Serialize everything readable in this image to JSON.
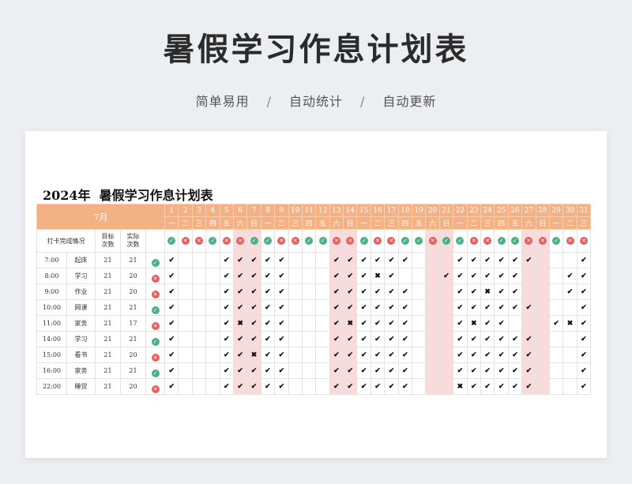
{
  "header": {
    "title": "暑假学习作息计划表",
    "features": [
      "简单易用",
      "自动统计",
      "自动更新"
    ],
    "separator": "/"
  },
  "sheet": {
    "title": "2024年  暑假学习作息计划表",
    "month": "7月",
    "stat_label": "打卡完成情况",
    "target_label": "目标\n次数",
    "actual_label": "实际\n次数",
    "days": [
      "1",
      "2",
      "3",
      "4",
      "5",
      "6",
      "7",
      "8",
      "9",
      "10",
      "11",
      "12",
      "13",
      "14",
      "15",
      "16",
      "17",
      "18",
      "19",
      "20",
      "21",
      "22",
      "23",
      "24",
      "25",
      "26",
      "27",
      "28",
      "29",
      "30",
      "31"
    ],
    "weekdays": [
      "一",
      "二",
      "三",
      "四",
      "五",
      "六",
      "日",
      "一",
      "二",
      "三",
      "四",
      "五",
      "六",
      "日",
      "一",
      "二",
      "三",
      "四",
      "五",
      "六",
      "日",
      "一",
      "二",
      "三",
      "四",
      "五",
      "六",
      "日",
      "一",
      "二",
      "三"
    ],
    "weekend_days": [
      "6",
      "7",
      "13",
      "14",
      "20",
      "21",
      "27",
      "28"
    ],
    "day_status": [
      "ok",
      "no",
      "no",
      "ok",
      "no",
      "no",
      "ok",
      "ok",
      "no",
      "no",
      "ok",
      "ok",
      "no",
      "no",
      "ok",
      "no",
      "no",
      "ok",
      "ok",
      "no",
      "ok",
      "ok",
      "no",
      "no",
      "ok",
      "ok",
      "no",
      "no",
      "ok",
      "no",
      "no"
    ],
    "rows": [
      {
        "time": "7:00",
        "task": "起床",
        "target": "21",
        "actual": "21",
        "status": "ok",
        "marks": "c---ccccc---cccccc---cccccc---cc"
      },
      {
        "time": "8:00",
        "task": "学习",
        "target": "21",
        "actual": "20",
        "status": "no",
        "marks": "c---ccccc---cccxc---cccccc---cc"
      },
      {
        "time": "9:00",
        "task": "作业",
        "target": "21",
        "actual": "20",
        "status": "no",
        "marks": "c---ccccc---cccccc---ccxcc---cc"
      },
      {
        "time": "10:00",
        "task": "网课",
        "target": "21",
        "actual": "21",
        "status": "ok",
        "marks": "c---ccccc---cccccc---cccccc---cc"
      },
      {
        "time": "11:00",
        "task": "家务",
        "target": "21",
        "actual": "17",
        "status": "no",
        "marks": "c---cxccc---cxcccc---cxcc---cxc"
      },
      {
        "time": "14:00",
        "task": "学习",
        "target": "21",
        "actual": "21",
        "status": "ok",
        "marks": "c---ccccc---cccccc---cccccc---cc"
      },
      {
        "time": "15:00",
        "task": "看书",
        "target": "21",
        "actual": "20",
        "status": "no",
        "marks": "c---ccxcc---cccccc---cccccc---cc"
      },
      {
        "time": "16:00",
        "task": "家务",
        "target": "21",
        "actual": "21",
        "status": "ok",
        "marks": "c---ccccc---cccccc---cccccc---cc"
      },
      {
        "time": "22:00",
        "task": "睡觉",
        "target": "21",
        "actual": "20",
        "status": "no",
        "marks": "c---ccccc---cccccc---xccccc---cc"
      }
    ],
    "check_glyph": "✔",
    "cross_glyph": "✖",
    "ok_glyph": "✓",
    "no_glyph": "✕"
  }
}
